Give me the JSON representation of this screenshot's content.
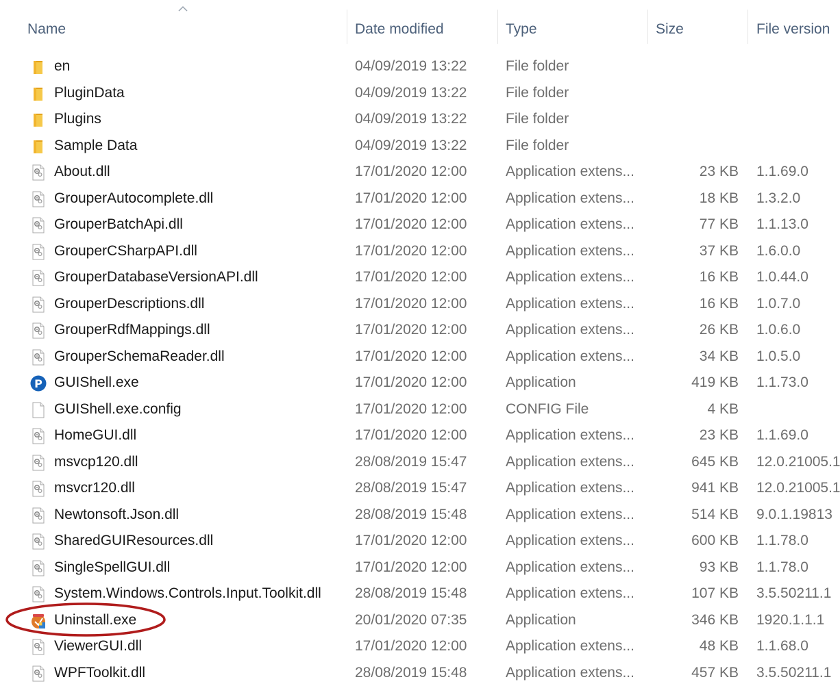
{
  "columns": {
    "name": "Name",
    "date": "Date modified",
    "type": "Type",
    "size": "Size",
    "version": "File version"
  },
  "colors": {
    "header_text": "#4c607a",
    "secondary_text": "#6e6e6e",
    "folder": "#f3c242",
    "highlight": "#b01c1c",
    "shell_icon": "#1662b8"
  },
  "files": [
    {
      "icon": "folder-icon",
      "name": "en",
      "date": "04/09/2019 13:22",
      "type": "File folder",
      "size": "",
      "version": ""
    },
    {
      "icon": "folder-icon",
      "name": "PluginData",
      "date": "04/09/2019 13:22",
      "type": "File folder",
      "size": "",
      "version": ""
    },
    {
      "icon": "folder-icon",
      "name": "Plugins",
      "date": "04/09/2019 13:22",
      "type": "File folder",
      "size": "",
      "version": ""
    },
    {
      "icon": "folder-icon",
      "name": "Sample Data",
      "date": "04/09/2019 13:22",
      "type": "File folder",
      "size": "",
      "version": ""
    },
    {
      "icon": "dll-icon",
      "name": "About.dll",
      "date": "17/01/2020 12:00",
      "type": "Application extens...",
      "size": "23 KB",
      "version": "1.1.69.0"
    },
    {
      "icon": "dll-icon",
      "name": "GrouperAutocomplete.dll",
      "date": "17/01/2020 12:00",
      "type": "Application extens...",
      "size": "18 KB",
      "version": "1.3.2.0"
    },
    {
      "icon": "dll-icon",
      "name": "GrouperBatchApi.dll",
      "date": "17/01/2020 12:00",
      "type": "Application extens...",
      "size": "77 KB",
      "version": "1.1.13.0"
    },
    {
      "icon": "dll-icon",
      "name": "GrouperCSharpAPI.dll",
      "date": "17/01/2020 12:00",
      "type": "Application extens...",
      "size": "37 KB",
      "version": "1.6.0.0"
    },
    {
      "icon": "dll-icon",
      "name": "GrouperDatabaseVersionAPI.dll",
      "date": "17/01/2020 12:00",
      "type": "Application extens...",
      "size": "16 KB",
      "version": "1.0.44.0"
    },
    {
      "icon": "dll-icon",
      "name": "GrouperDescriptions.dll",
      "date": "17/01/2020 12:00",
      "type": "Application extens...",
      "size": "16 KB",
      "version": "1.0.7.0"
    },
    {
      "icon": "dll-icon",
      "name": "GrouperRdfMappings.dll",
      "date": "17/01/2020 12:00",
      "type": "Application extens...",
      "size": "26 KB",
      "version": "1.0.6.0"
    },
    {
      "icon": "dll-icon",
      "name": "GrouperSchemaReader.dll",
      "date": "17/01/2020 12:00",
      "type": "Application extens...",
      "size": "34 KB",
      "version": "1.0.5.0"
    },
    {
      "icon": "guishell-icon",
      "name": "GUIShell.exe",
      "date": "17/01/2020 12:00",
      "type": "Application",
      "size": "419 KB",
      "version": "1.1.73.0"
    },
    {
      "icon": "config-file-icon",
      "name": "GUIShell.exe.config",
      "date": "17/01/2020 12:00",
      "type": "CONFIG File",
      "size": "4 KB",
      "version": ""
    },
    {
      "icon": "dll-icon",
      "name": "HomeGUI.dll",
      "date": "17/01/2020 12:00",
      "type": "Application extens...",
      "size": "23 KB",
      "version": "1.1.69.0"
    },
    {
      "icon": "dll-icon",
      "name": "msvcp120.dll",
      "date": "28/08/2019 15:47",
      "type": "Application extens...",
      "size": "645 KB",
      "version": "12.0.21005.1"
    },
    {
      "icon": "dll-icon",
      "name": "msvcr120.dll",
      "date": "28/08/2019 15:47",
      "type": "Application extens...",
      "size": "941 KB",
      "version": "12.0.21005.1"
    },
    {
      "icon": "dll-icon",
      "name": "Newtonsoft.Json.dll",
      "date": "28/08/2019 15:48",
      "type": "Application extens...",
      "size": "514 KB",
      "version": "9.0.1.19813"
    },
    {
      "icon": "dll-icon",
      "name": "SharedGUIResources.dll",
      "date": "17/01/2020 12:00",
      "type": "Application extens...",
      "size": "600 KB",
      "version": "1.1.78.0"
    },
    {
      "icon": "dll-icon",
      "name": "SingleSpellGUI.dll",
      "date": "17/01/2020 12:00",
      "type": "Application extens...",
      "size": "93 KB",
      "version": "1.1.78.0"
    },
    {
      "icon": "dll-icon",
      "name": "System.Windows.Controls.Input.Toolkit.dll",
      "date": "28/08/2019 15:48",
      "type": "Application extens...",
      "size": "107 KB",
      "version": "3.5.50211.1"
    },
    {
      "icon": "uninstaller-icon",
      "name": "Uninstall.exe",
      "date": "20/01/2020 07:35",
      "type": "Application",
      "size": "346 KB",
      "version": "1920.1.1.1"
    },
    {
      "icon": "dll-icon",
      "name": "ViewerGUI.dll",
      "date": "17/01/2020 12:00",
      "type": "Application extens...",
      "size": "48 KB",
      "version": "1.1.68.0"
    },
    {
      "icon": "dll-icon",
      "name": "WPFToolkit.dll",
      "date": "28/08/2019 15:48",
      "type": "Application extens...",
      "size": "457 KB",
      "version": "3.5.50211.1"
    }
  ]
}
